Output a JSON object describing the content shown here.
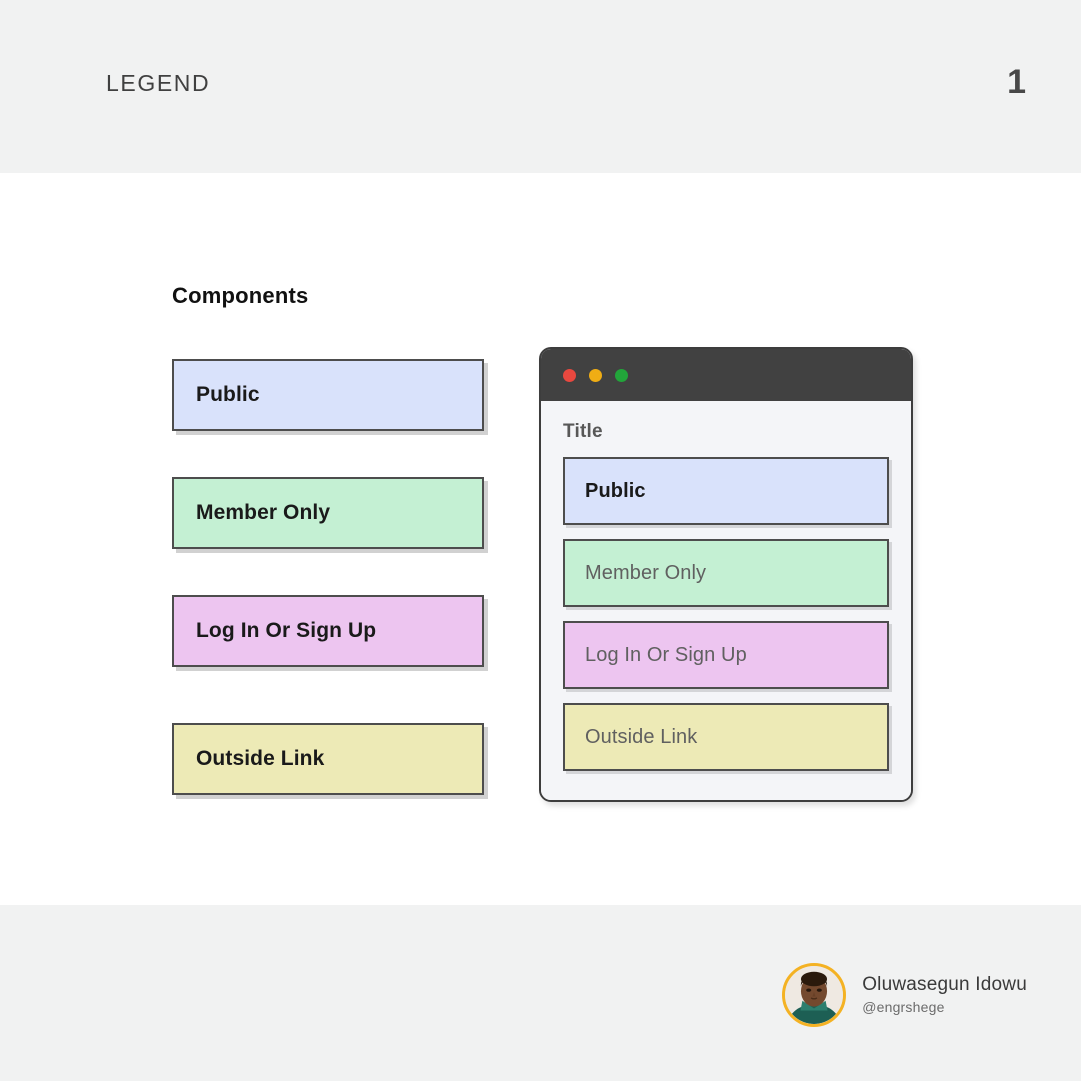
{
  "header": {
    "title": "LEGEND",
    "page_number": "1"
  },
  "slide": {
    "section_heading": "Components",
    "legend_items": [
      {
        "label": "Public",
        "fill": "#d9e2fb",
        "border": "#4d4d4d",
        "text_color": "#1a1a1a"
      },
      {
        "label": "Member Only",
        "fill": "#c4f0d3",
        "border": "#4d4d4d",
        "text_color": "#1a1a1a"
      },
      {
        "label": "Log In Or Sign Up",
        "fill": "#edc5f0",
        "border": "#4d4d4d",
        "text_color": "#1a1a1a"
      },
      {
        "label": "Outside Link",
        "fill": "#edeab6",
        "border": "#4d4d4d",
        "text_color": "#1a1a1a"
      }
    ],
    "browser": {
      "traffic_lights": [
        {
          "name": "close",
          "color": "#e8483f"
        },
        {
          "name": "minimize",
          "color": "#f0ad14"
        },
        {
          "name": "maximize",
          "color": "#22a53a"
        }
      ],
      "content_title": "Title",
      "items": [
        {
          "label": "Public",
          "fill": "#d9e2fb",
          "text_color": "#1a1a1a",
          "weight": "700"
        },
        {
          "label": "Member Only",
          "fill": "#c4f0d3",
          "text_color": "#606060",
          "weight": "400"
        },
        {
          "label": "Log In Or Sign Up",
          "fill": "#edc5f0",
          "text_color": "#606060",
          "weight": "400"
        },
        {
          "label": "Outside Link",
          "fill": "#edeab6",
          "text_color": "#606060",
          "weight": "400"
        }
      ]
    }
  },
  "footer": {
    "author_name": "Oluwasegun Idowu",
    "author_handle": "@engrshege",
    "avatar_ring_color": "#f4b223"
  }
}
